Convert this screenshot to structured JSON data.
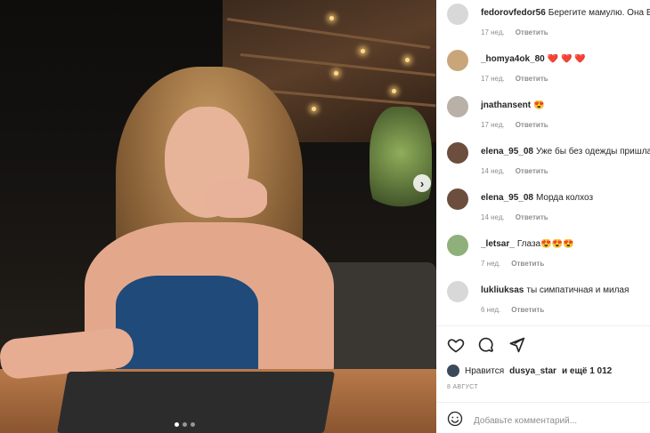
{
  "post": {
    "carousel": {
      "total": 3,
      "active": 1,
      "next_icon": "chevron-right-icon"
    }
  },
  "comments": [
    {
      "username": "fedorovfedor56",
      "text": "Берегите мамулю. Она Ва",
      "time": "17 нед.",
      "reply": "Ответить",
      "avatar": "#d8d8d8"
    },
    {
      "username": "_homya4ok_80",
      "text": "❤️ ❤️ ❤️",
      "time": "17 нед.",
      "reply": "Ответить",
      "avatar": "#c9a67a"
    },
    {
      "username": "jnathansent",
      "text": "😍",
      "time": "17 нед.",
      "reply": "Ответить",
      "avatar": "#b9b0a8"
    },
    {
      "username": "elena_95_08",
      "text": "Уже бы без одежды пришла",
      "time": "14 нед.",
      "reply": "Ответить",
      "avatar": "#6b4e3e"
    },
    {
      "username": "elena_95_08",
      "text": "Морда колхоз",
      "time": "14 нед.",
      "reply": "Ответить",
      "avatar": "#6b4e3e"
    },
    {
      "username": "_letsar_",
      "text": "Глаза😍😍😍",
      "time": "7 нед.",
      "reply": "Ответить",
      "avatar": "#8fb07a"
    },
    {
      "username": "lukliuksas",
      "text": "ты симпатичная и милая",
      "time": "6 нед.",
      "reply": "Ответить",
      "avatar": "#d8d8d8"
    }
  ],
  "actions": {
    "like_icon": "heart-icon",
    "comment_icon": "comment-icon",
    "share_icon": "share-icon"
  },
  "likes": {
    "prefix": "Нравится",
    "user": "dusya_star",
    "suffix": "и ещё 1 012"
  },
  "date": "8 АВГУСТ",
  "add_comment": {
    "emoji_icon": "smiley-icon",
    "placeholder": "Добавьте комментарий..."
  }
}
